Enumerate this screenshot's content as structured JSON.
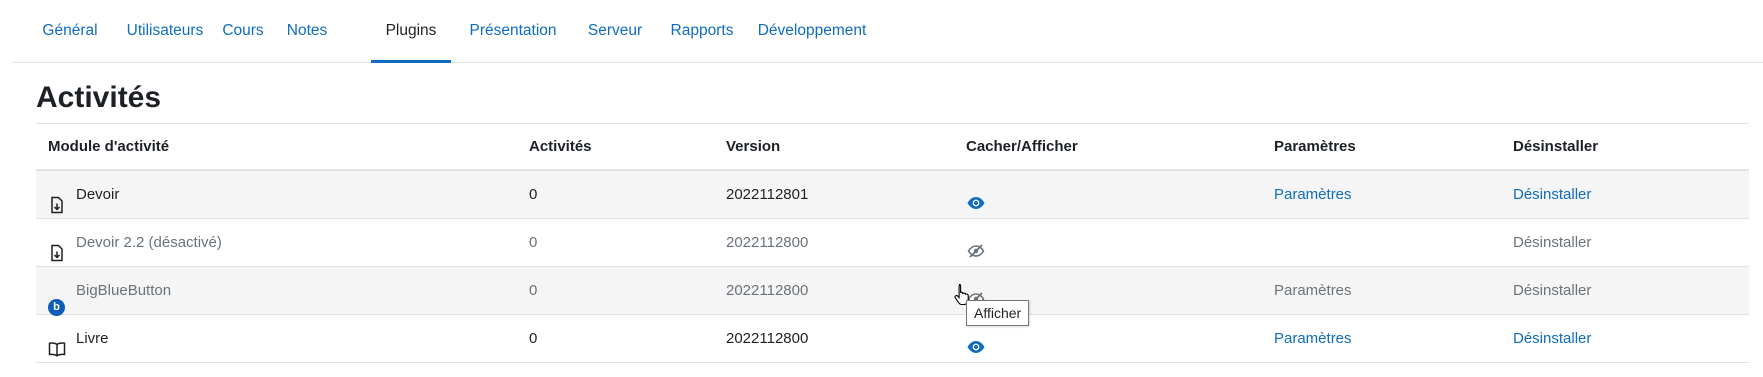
{
  "tabs": [
    {
      "label": "Général"
    },
    {
      "label": "Utilisateurs"
    },
    {
      "label": "Cours"
    },
    {
      "label": "Notes"
    },
    {
      "label": "Plugins"
    },
    {
      "label": "Présentation"
    },
    {
      "label": "Serveur"
    },
    {
      "label": "Rapports"
    },
    {
      "label": "Développement"
    }
  ],
  "active_tab": "Plugins",
  "page_title": "Activités",
  "table": {
    "headers": {
      "module": "Module d'activité",
      "activities": "Activités",
      "version": "Version",
      "visibility": "Cacher/Afficher",
      "settings": "Paramètres",
      "uninstall": "Désinstaller"
    },
    "rows": [
      {
        "name": "Devoir",
        "activities": "0",
        "version": "2022112801",
        "visibility_icon": "eye-icon",
        "settings": "Paramètres",
        "uninstall": "Désinstaller"
      },
      {
        "name": "Devoir 2.2 (désactivé)",
        "activities": "0",
        "version": "2022112800",
        "visibility_icon": "eye-slash-icon",
        "settings": "",
        "uninstall": "Désinstaller"
      },
      {
        "name": "BigBlueButton",
        "activities": "0",
        "version": "2022112800",
        "visibility_icon": "eye-slash-icon",
        "settings": "Paramètres",
        "uninstall": "Désinstaller",
        "icon_letter": "b"
      },
      {
        "name": "Livre",
        "activities": "0",
        "version": "2022112800",
        "visibility_icon": "eye-icon",
        "settings": "Paramètres",
        "uninstall": "Désinstaller"
      }
    ]
  },
  "tooltip": "Afficher",
  "colors": {
    "link": "#0f6cbf",
    "muted": "#6a737b",
    "text": "#1d2125",
    "row_alt": "#f5f5f5",
    "bbb": "#0f5db8"
  }
}
